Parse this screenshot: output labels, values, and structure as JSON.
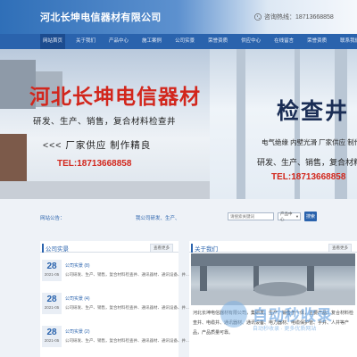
{
  "header": {
    "site_title": "河北长坤电信器材有限公司",
    "phone": "咨询热线：18713668858"
  },
  "nav": [
    "网站首页",
    "关于我们",
    "产品中心",
    "施工案例",
    "公司实景",
    "荣誉资质",
    "供应中心",
    "在线留言",
    "荣誉资质",
    "联系我们"
  ],
  "banner": {
    "title": "河北长坤电信器材",
    "subtitle": "研发、生产、销售，复合材料检查井",
    "slogan": "<<< 厂家供应  制作精良",
    "tel": "TEL:18713668858",
    "right_title": "检查井",
    "right_subtitle": "电气绝缘 内壁光滑 厂家供应 制作",
    "right_subtitle2": "研发、生产、销售，复合材料",
    "right_tel": "TEL:18713668858"
  },
  "notice": {
    "label": "网站公告：",
    "text": "我公司研发、生产、"
  },
  "search": {
    "placeholder": "请搜索关键词",
    "select_value": "产品中心",
    "button": "搜索"
  },
  "company_news": {
    "title": "公司实景",
    "more": "查看更多",
    "items": [
      {
        "day": "28",
        "ym": "2021-05",
        "title": "公司实景 (8)",
        "snippet": "公司研发、生产、销售，复合材料检查井、通讯器材、通讯设备、井..."
      },
      {
        "day": "28",
        "ym": "2021-05",
        "title": "公司实景 (4)",
        "snippet": "公司研发、生产、销售，复合材料检查井、通讯器材、通讯设备、井..."
      },
      {
        "day": "28",
        "ym": "2021-05",
        "title": "公司实景 (2)",
        "snippet": "公司研发、生产、销售，复合材料检查井、通讯器材、通讯设备、井..."
      }
    ]
  },
  "about": {
    "title": "关于我们",
    "more": "查看更多",
    "text": "河北长坤电信器材有限公司，集研发、生产、销售于一体，主要产品：复合材料检查井、电缆井、通讯器材、通讯设备、电力器材、电缆保护管、手井、人井等产品，产品质量可靠。"
  },
  "watermark": {
    "text": "自动秒收录",
    "sub": "自动秒收录 · 更多优质网站"
  }
}
